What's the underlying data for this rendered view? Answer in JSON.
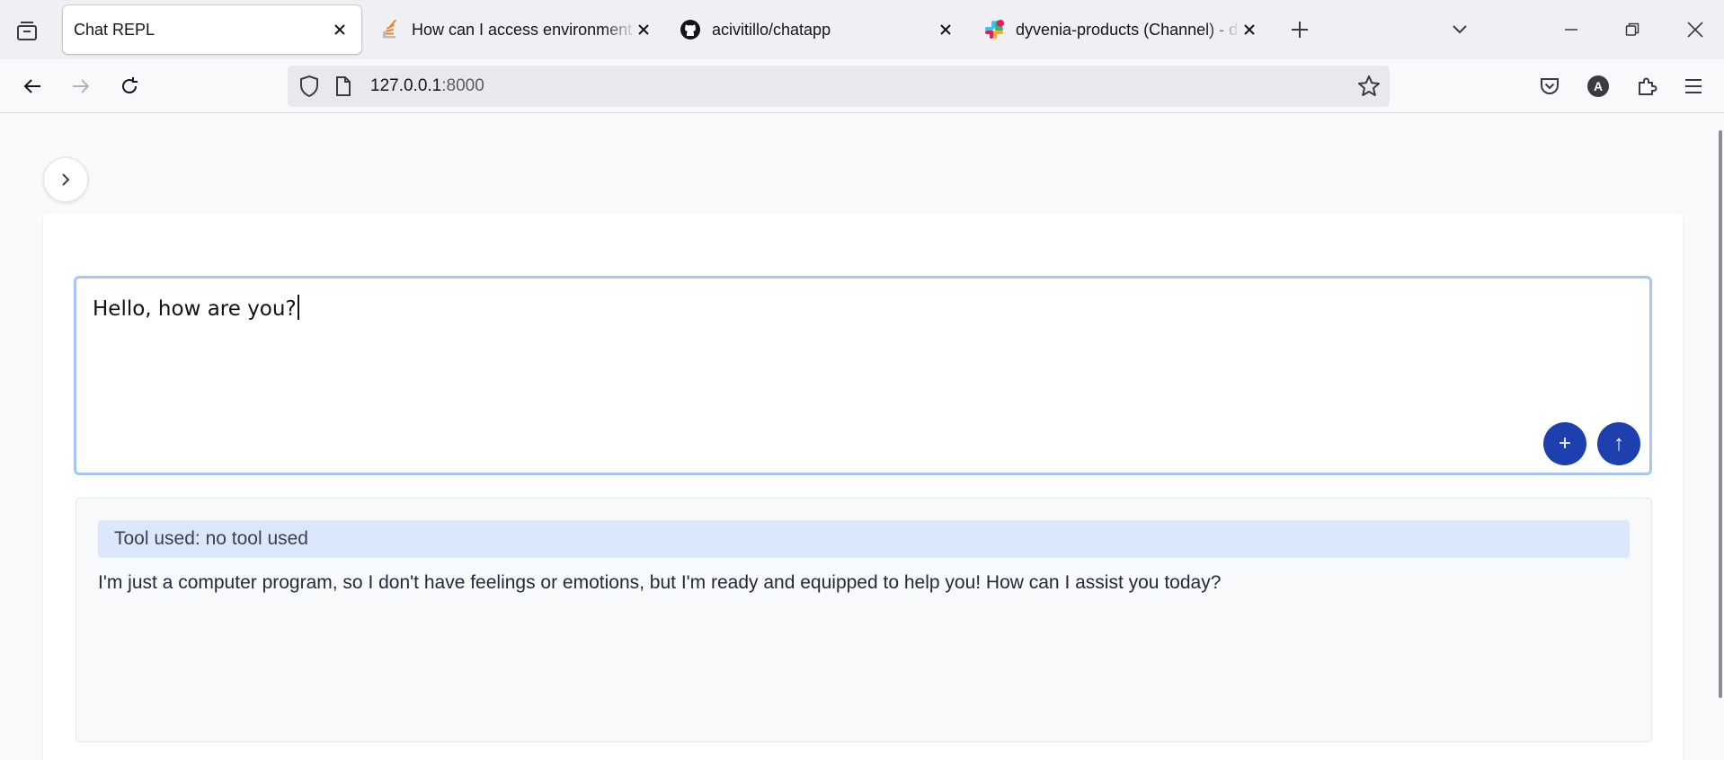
{
  "browser": {
    "tabs": [
      {
        "title": "Chat REPL",
        "favicon": "none",
        "active": true
      },
      {
        "title": "How can I access environment v",
        "favicon": "stackoverflow-icon",
        "active": false
      },
      {
        "title": "acivitillo/chatapp",
        "favicon": "github-icon",
        "active": false
      },
      {
        "title": "dyvenia-products (Channel) - dy",
        "favicon": "slack-icon",
        "active": false
      }
    ],
    "url": {
      "host": "127.0.0.1",
      "port": ":8000"
    },
    "profile_initial": "A"
  },
  "chat": {
    "prompt_value": "Hello, how are you?",
    "attach_label": "+",
    "send_label": "↑",
    "tool_used": "Tool used: no tool used",
    "answer": "I'm just a computer program, so I don't have feelings or emotions, but I'm ready and equipped to help you! How can I assist you today?"
  },
  "colors": {
    "accent": "#1e40af",
    "prompt_border": "#a7c5f5",
    "tool_badge_bg": "#dbe8fb"
  }
}
